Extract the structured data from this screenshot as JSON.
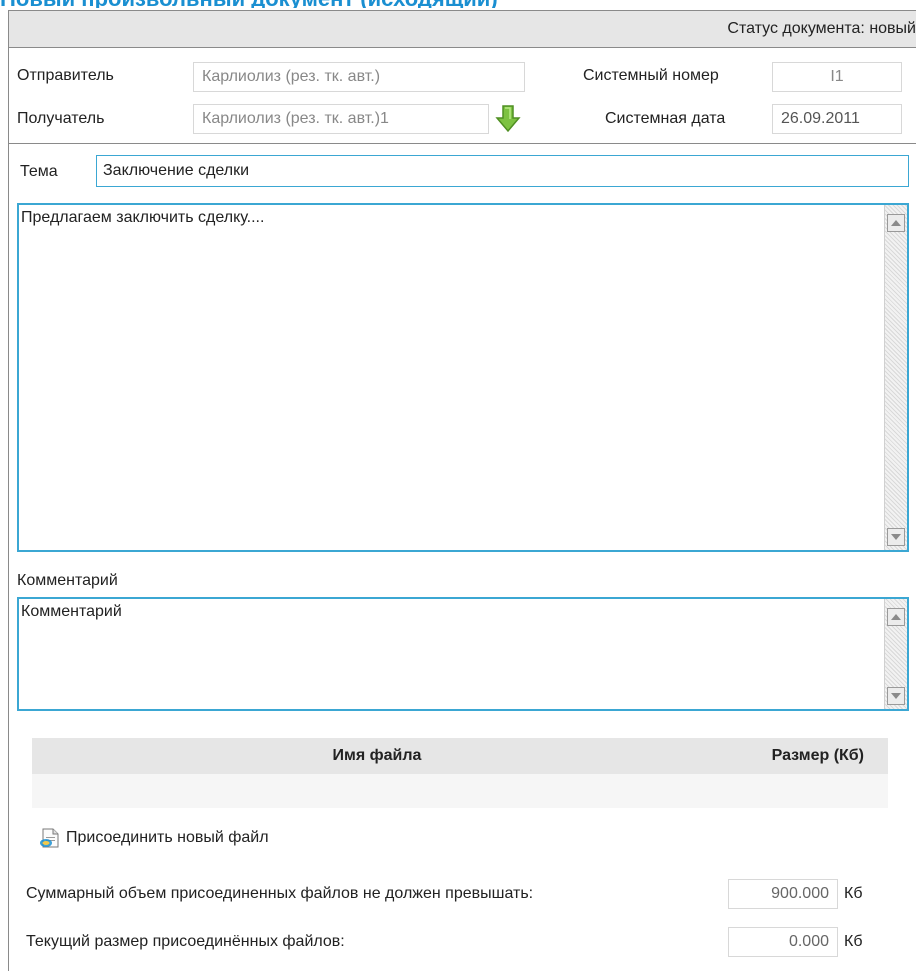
{
  "header": {
    "title": "Новый произвольный документ (исходящий)",
    "status": "Статус документа: новый"
  },
  "sender": {
    "label": "Отправитель",
    "value": "Карлиолиз (рез. тк. авт.)"
  },
  "recipient": {
    "label": "Получатель",
    "value": "Карлиолиз (рез. тк. авт.)1"
  },
  "system_number": {
    "label": "Системный номер",
    "value": "I1"
  },
  "system_date": {
    "label": "Системная дата",
    "value": "26.09.2011"
  },
  "subject": {
    "label": "Тема",
    "value": "Заключение сделки"
  },
  "body_text": "Предлагаем заключить сделку....",
  "comment": {
    "label": "Комментарий",
    "value": "Комментарий"
  },
  "files": {
    "columns": [
      "Имя файла",
      "Размер (Кб)"
    ],
    "rows": [],
    "attach_label": "Присоединить новый файл"
  },
  "limits": {
    "max_label": "Суммарный объем присоединенных файлов не должен превышать:",
    "max_value": "900.000",
    "current_label": "Текущий размер присоединённых файлов:",
    "current_value": "0.000",
    "unit": "Кб"
  },
  "colors": {
    "accent": "#3ba7d3",
    "title": "#1a8fd1",
    "icon_green": "#7dc242"
  },
  "icons": {
    "recipient_action": "green-down-arrow-icon",
    "attach": "attach-document-icon"
  }
}
